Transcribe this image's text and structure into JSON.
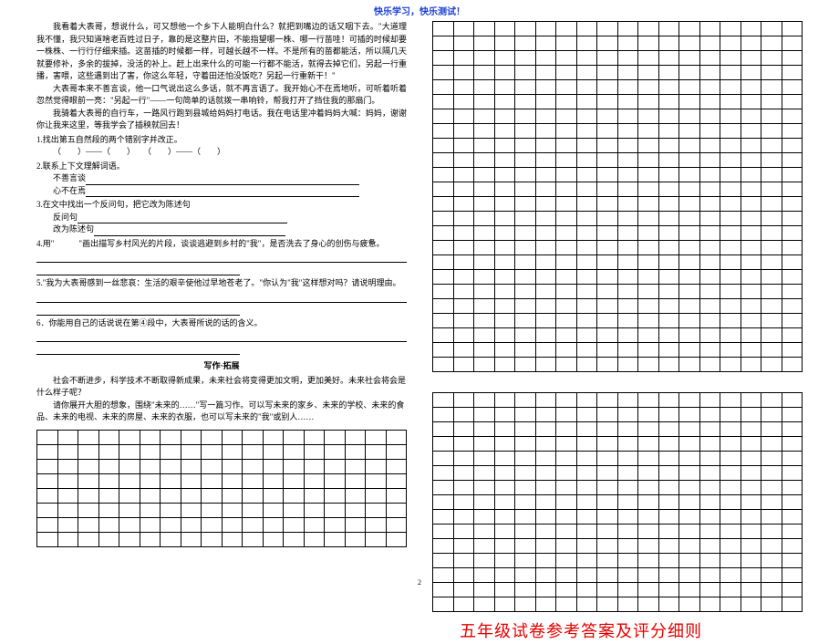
{
  "header": "快乐学习，快乐测试！",
  "passage": {
    "p1": "我看着大表哥，想说什么，可又想他一个乡下人能明白什么？就把到嘴边的话又咽下去。\"大道理我不懂，我只知道啥老百姓过日子，靠的是这整片田，不能指望哪一株、哪一行苗哇！可插的时候却要一株株、一行行仔细来插。这苗插的时候都一样，可越长越不一样。不是所有的苗都能活，所以隔几天就要修补，多余的拔掉，没活的补上。赶上出来什么的可能一行都不能活，就得去掉它们，另起一行重播，害喂，这些遇到出了害，你这么年轻，守着田还怕没饭吃？另起一行重新干！\"",
    "p2": "大表哥本来不善言谈，他一口气说出这么多话，就不再言语了。我开始心不在焉地听，可听着听着忽然觉得眼前一亮：\"另起一行\"――一句简单的话就拨一串响铃，帮我打开了挡住我的那扇门。",
    "p3": "我骑着大表哥的自行车，一路风行跑到县城给妈妈打电话。我在电话里冲着妈妈大喊：妈妈，谢谢你让我来这里，等我学会了插秧就回去！"
  },
  "q1": {
    "text": "1.找出第五自然段的两个错别字并改正。",
    "blanks": "（　　）――（　　）　　（　　）――（　　）"
  },
  "q2": {
    "text": "2.联系上下文理解词语。",
    "w1": "不善言谈",
    "w2": "心不在焉"
  },
  "q3": {
    "text": "3.在文中找出一个反问句，把它改为陈述句",
    "l1": "反问句",
    "l2": "改为陈述句"
  },
  "q4": {
    "text": "4.用\"　　　\"画出描写乡村风光的片段，谈谈逃避到乡村的\"我\"，是否洗去了身心的创伤与疲惫。"
  },
  "q5": {
    "text": "5.\"我为大表哥感到一丝悲哀：生活的艰辛使他过早地苍老了。\"你认为\"我\"这样想对吗？请说明理由。"
  },
  "q6": {
    "text": "6．你能用自己的话说说在第④段中，大表哥所说的话的含义。"
  },
  "writing": {
    "title": "写作·拓展",
    "p1": "社会不断进步，科学技术不断取得新成果，未来社会将变得更加文明，更加美好。未来社会将会是什么样子呢？",
    "p2": "请你展开大胆的想象，围绕\"未来的……\"写一篇习作。可以写未来的家乡、未来的学校、未来的食品、未来的电视、未来的房屋、未来的衣服，也可以写未来的\"我\"或别人……"
  },
  "answerTitle": "五年级试卷参考答案及评分细则",
  "pageNum": "2",
  "gridLeft": {
    "rows": 8,
    "cols": 18
  },
  "gridRightTop": {
    "rows": 24,
    "cols": 18
  },
  "gridRightBottom": {
    "rows": 15,
    "cols": 18
  }
}
